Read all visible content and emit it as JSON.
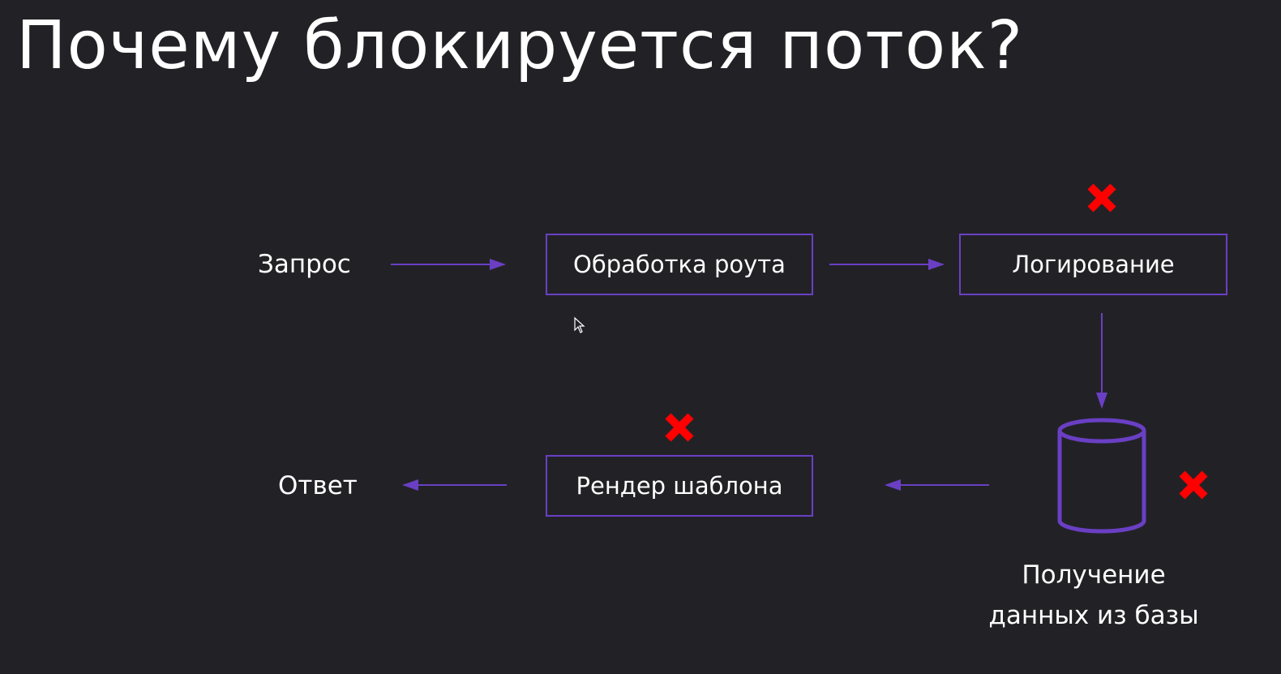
{
  "slide": {
    "title": "Почему блокируется поток?"
  },
  "diagram": {
    "request_label": "Запрос",
    "route_box": "Обработка роута",
    "logging_box": "Логирование",
    "db_caption_line1": "Получение",
    "db_caption_line2": "данных из базы",
    "render_box": "Рендер шаблона",
    "response_label": "Ответ",
    "blocked_marker_icon": "red-x-icon",
    "database_icon": "database-cylinder-icon"
  },
  "colors": {
    "background": "#222226",
    "accent": "#6a3fc4",
    "blocked": "#ff0000",
    "text": "#ffffff"
  }
}
